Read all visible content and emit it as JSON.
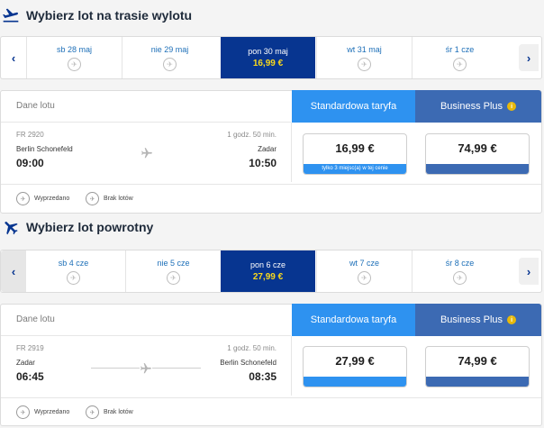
{
  "outbound": {
    "title": "Wybierz lot na trasie wylotu",
    "dates": [
      {
        "label": "sb 28 maj",
        "price": ""
      },
      {
        "label": "nie 29 maj",
        "price": ""
      },
      {
        "label": "pon 30 maj",
        "price": "16,99 €"
      },
      {
        "label": "wt 31 maj",
        "price": ""
      },
      {
        "label": "śr 1 cze",
        "price": ""
      }
    ],
    "header_label": "Dane lotu",
    "tab_standard": "Standardowa taryfa",
    "tab_business": "Business Plus",
    "flight": {
      "number": "FR 2920",
      "duration": "1 godz. 50 min.",
      "from": "Berlin Schonefeld",
      "to": "Zadar",
      "depart": "09:00",
      "arrive": "10:50"
    },
    "standard_price": "16,99 €",
    "standard_note": "tylko 3 miejsc(a) w tej cenie",
    "business_price": "74,99 €",
    "legend_soldout": "Wyprzedano",
    "legend_noflights": "Brak lotów"
  },
  "return": {
    "title": "Wybierz lot powrotny",
    "dates": [
      {
        "label": "sb 4 cze",
        "price": ""
      },
      {
        "label": "nie 5 cze",
        "price": ""
      },
      {
        "label": "pon 6 cze",
        "price": "27,99 €"
      },
      {
        "label": "wt 7 cze",
        "price": ""
      },
      {
        "label": "śr 8 cze",
        "price": ""
      }
    ],
    "header_label": "Dane lotu",
    "tab_standard": "Standardowa taryfa",
    "tab_business": "Business Plus",
    "flight": {
      "number": "FR 2919",
      "duration": "1 godz. 50 min.",
      "from": "Zadar",
      "to": "Berlin Schonefeld",
      "depart": "06:45",
      "arrive": "08:35"
    },
    "standard_price": "27,99 €",
    "business_price": "74,99 €",
    "legend_soldout": "Wyprzedano",
    "legend_noflights": "Brak lotów"
  },
  "colors": {
    "selected_bg": "#073590",
    "selected_price": "#f8d81d",
    "standard": "#2e92f0",
    "business": "#3c6ab3"
  }
}
